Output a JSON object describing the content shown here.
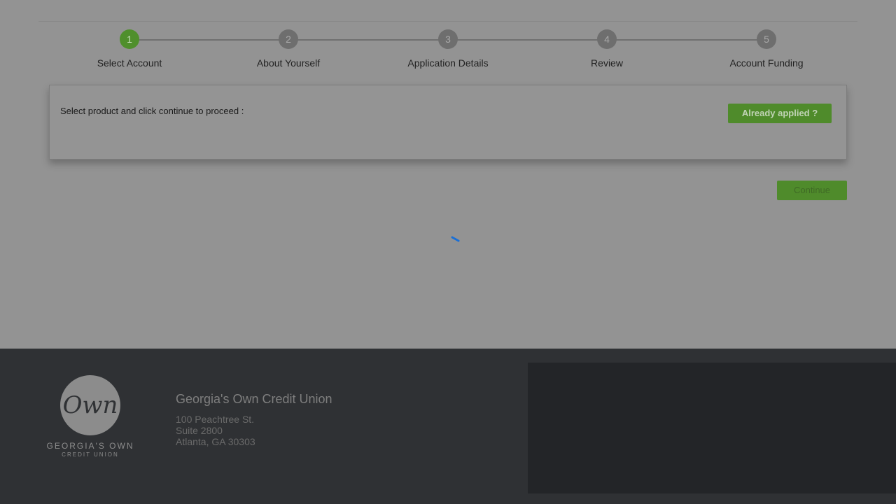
{
  "stepper": {
    "steps": [
      {
        "number": "1",
        "label": "Select Account",
        "active": true
      },
      {
        "number": "2",
        "label": "About Yourself",
        "active": false
      },
      {
        "number": "3",
        "label": "Application Details",
        "active": false
      },
      {
        "number": "4",
        "label": "Review",
        "active": false
      },
      {
        "number": "5",
        "label": "Account Funding",
        "active": false
      }
    ]
  },
  "panel": {
    "instruction": "Select product and click continue to proceed :",
    "already_applied_label": "Already applied ?"
  },
  "actions": {
    "continue_label": "Continue"
  },
  "loading": {
    "spinner_icon": "loading-spinner-icon",
    "color": "#1a6fd6"
  },
  "footer": {
    "logo": {
      "script": "Own",
      "name": "GEORGIA'S OWN",
      "sub": "CREDIT UNION"
    },
    "org_name": "Georgia's Own Credit Union",
    "address": {
      "line1": "100 Peachtree St.",
      "line2": "Suite 2800",
      "line3": "Atlanta, GA 30303"
    }
  },
  "colors": {
    "accent_green": "#4f8b2b",
    "overlay_gray": "#939393",
    "footer_bg": "#2f3134"
  }
}
